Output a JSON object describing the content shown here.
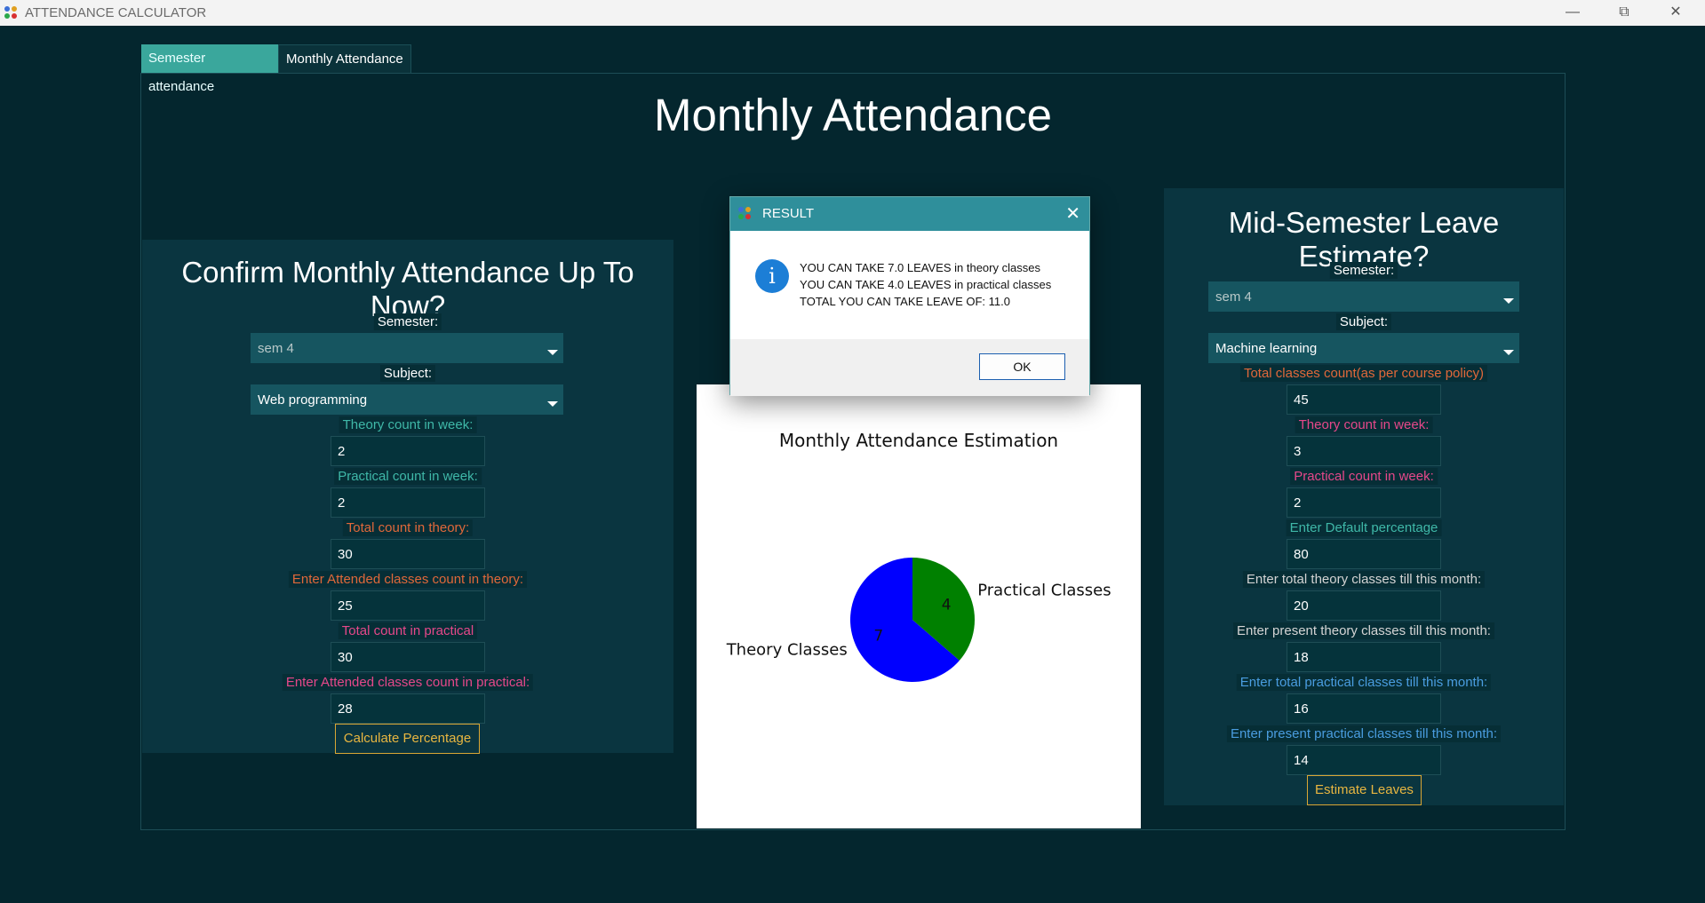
{
  "window": {
    "title": "ATTENDANCE CALCULATOR"
  },
  "tabs": [
    {
      "label": "Semester attendance"
    },
    {
      "label": "Monthly Attendance"
    }
  ],
  "main_title": "Monthly Attendance",
  "left_panel": {
    "title": "Confirm Monthly Attendance Up To Now?",
    "semester_label": "Semester:",
    "semester_value": "sem 4",
    "subject_label": "Subject:",
    "subject_value": "Web programming",
    "fields": [
      {
        "label": "Theory count in week:",
        "value": "2"
      },
      {
        "label": "Practical count in week:",
        "value": "2"
      },
      {
        "label": "Total count in theory:",
        "value": "30"
      },
      {
        "label": "Enter Attended classes count in theory:",
        "value": "25"
      },
      {
        "label": "Total count in practical",
        "value": "30"
      },
      {
        "label": "Enter Attended classes count in practical:",
        "value": "28"
      }
    ],
    "button_label": "Calculate Percentage"
  },
  "right_panel": {
    "title": "Mid-Semester Leave Estimate?",
    "semester_label": "Semester:",
    "semester_value": "sem 4",
    "subject_label": "Subject:",
    "subject_value": "Machine learning",
    "fields": [
      {
        "label": "Total classes count(as per course policy)",
        "value": "45"
      },
      {
        "label": "Theory count in week:",
        "value": "3"
      },
      {
        "label": "Practical count in week:",
        "value": "2"
      },
      {
        "label": "Enter Default percentage",
        "value": "80"
      },
      {
        "label": "Enter total theory classes till this month:",
        "value": "20"
      },
      {
        "label": "Enter present theory classes till this month:",
        "value": "18"
      },
      {
        "label": "Enter total practical classes till this month:",
        "value": "16"
      },
      {
        "label": "Enter present practical classes till this month:",
        "value": "14"
      }
    ],
    "button_label": "Estimate Leaves"
  },
  "chart_data": {
    "type": "pie",
    "title": "Monthly Attendance Estimation",
    "categories": [
      "Theory Classes",
      "Practical Classes"
    ],
    "values": [
      7,
      4
    ],
    "colors": [
      "#0000ff",
      "#008000"
    ]
  },
  "dialog": {
    "title": "RESULT",
    "icon": "info-icon",
    "lines": [
      "YOU CAN TAKE 7.0 LEAVES in theory classes",
      "YOU CAN TAKE 4.0 LEAVES in practical classes",
      "TOTAL YOU CAN TAKE LEAVE OF: 11.0"
    ],
    "ok_label": "OK"
  },
  "colors": {
    "background": "#04262e",
    "panel": "#0a3540",
    "accent_tab": "#3aa79c",
    "button_border": "#d9a634",
    "dialog_header": "#2f8f9b"
  }
}
